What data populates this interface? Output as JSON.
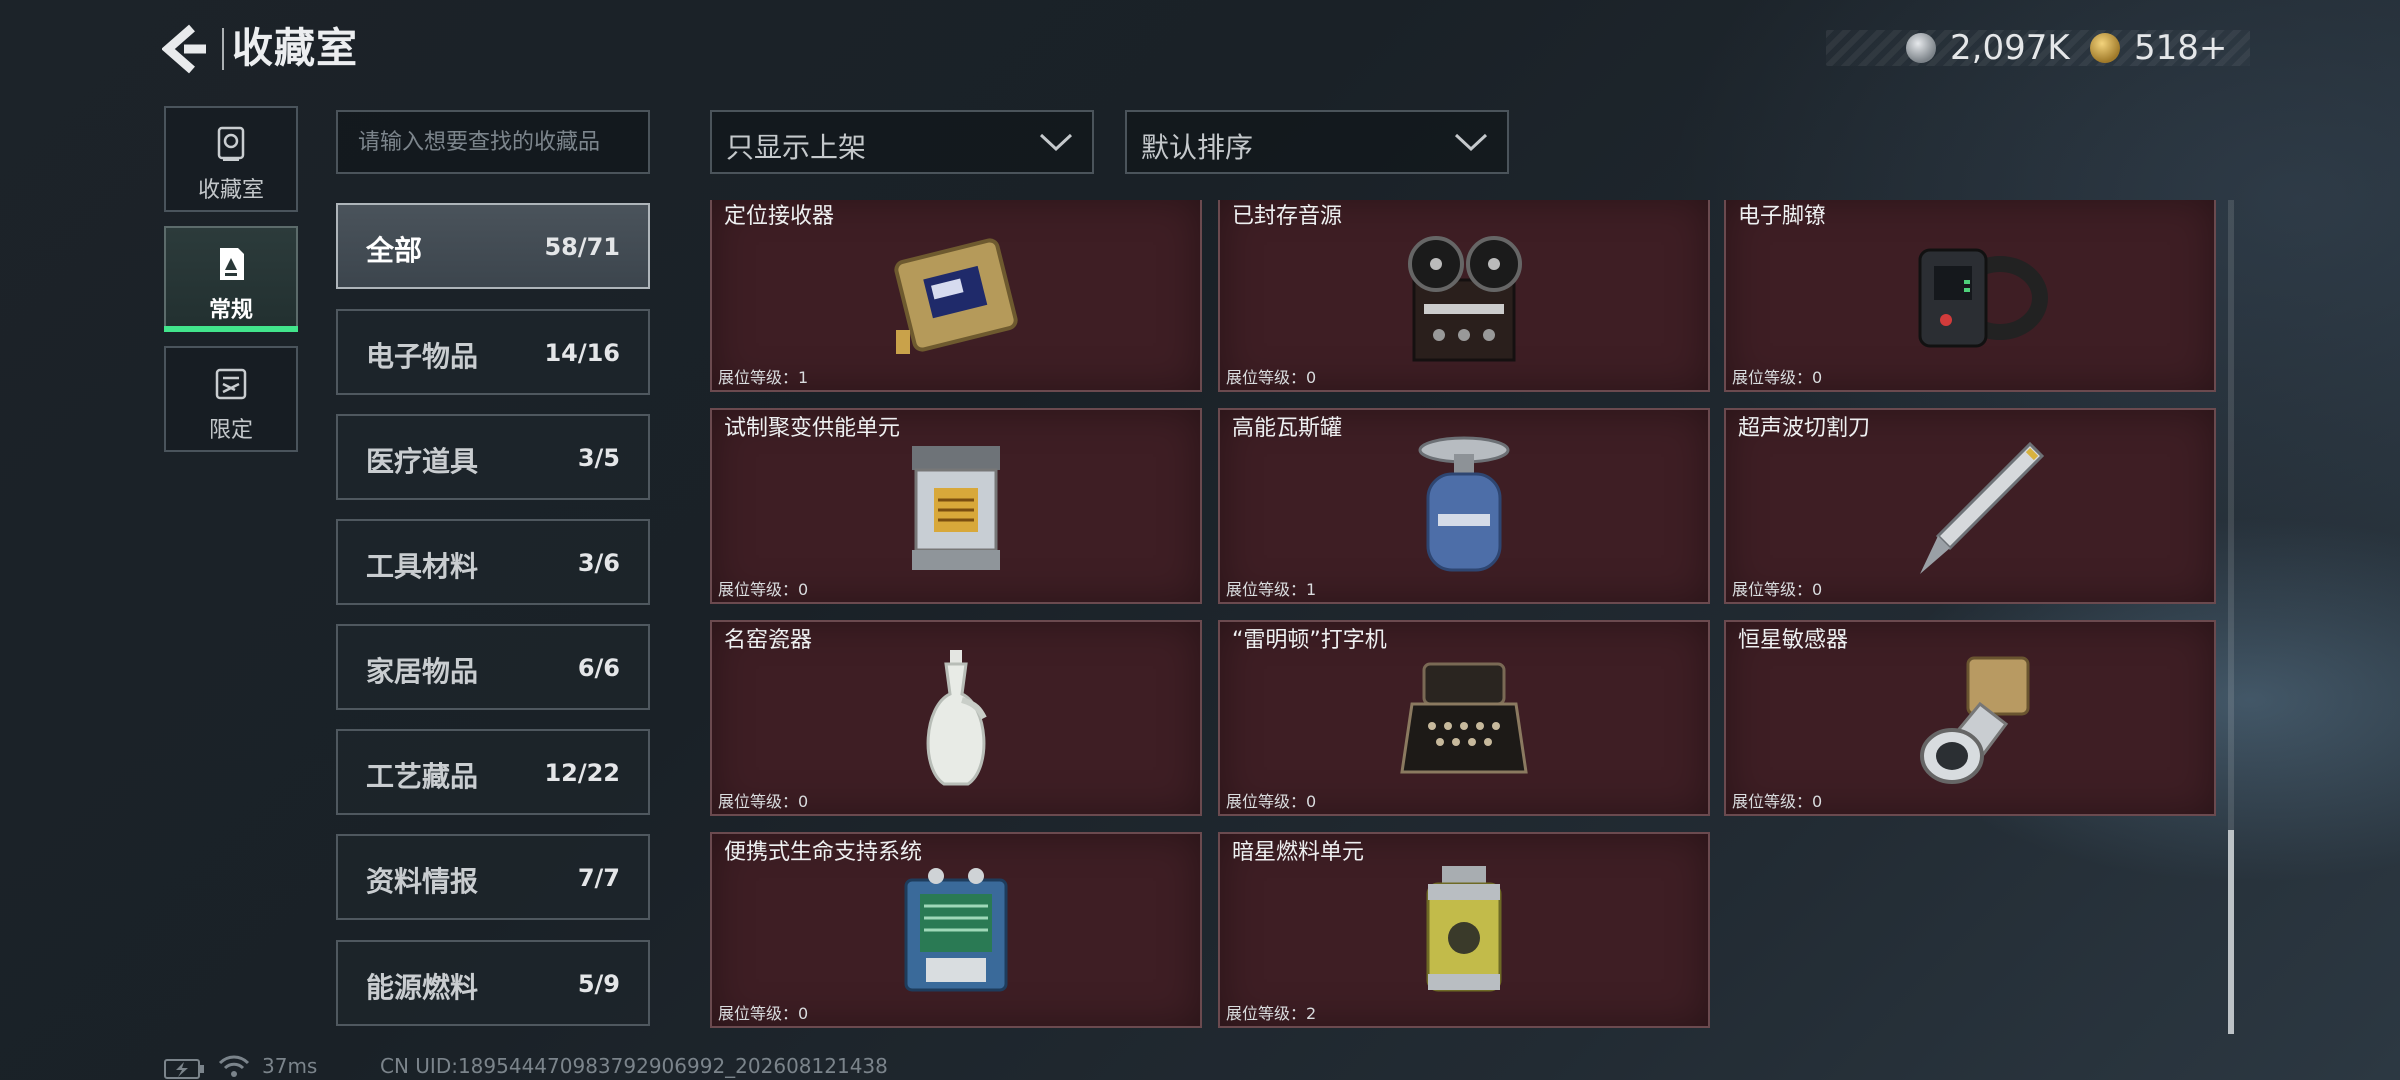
{
  "header": {
    "title": "收藏室"
  },
  "currency": {
    "primary": "2,097K",
    "secondary": "518+"
  },
  "modes": [
    {
      "label": "收藏室",
      "icon": "trophy-icon"
    },
    {
      "label": "常规",
      "icon": "collection-icon",
      "active": true
    },
    {
      "label": "限定",
      "icon": "limited-icon"
    }
  ],
  "search": {
    "placeholder": "请输入想要查找的收藏品"
  },
  "filters": {
    "display_value": "只显示上架",
    "sort_value": "默认排序"
  },
  "categories": [
    {
      "name": "全部",
      "count": "58/71",
      "active": true
    },
    {
      "name": "电子物品",
      "count": "14/16"
    },
    {
      "name": "医疗道具",
      "count": "3/5"
    },
    {
      "name": "工具材料",
      "count": "3/6"
    },
    {
      "name": "家居物品",
      "count": "6/6"
    },
    {
      "name": "工艺藏品",
      "count": "12/22"
    },
    {
      "name": "资料情报",
      "count": "7/7"
    },
    {
      "name": "能源燃料",
      "count": "5/9"
    }
  ],
  "items": [
    {
      "name": "定位接收器",
      "level": "展位等级：1",
      "icon": "receiver-icon"
    },
    {
      "name": "已封存音源",
      "level": "展位等级：0",
      "icon": "reel-recorder-icon"
    },
    {
      "name": "电子脚镣",
      "level": "展位等级：0",
      "icon": "ankle-monitor-icon"
    },
    {
      "name": "试制聚变供能单元",
      "level": "展位等级：0",
      "icon": "fusion-cell-icon"
    },
    {
      "name": "高能瓦斯罐",
      "level": "展位等级：1",
      "icon": "gas-tank-icon"
    },
    {
      "name": "超声波切割刀",
      "level": "展位等级：0",
      "icon": "ultrasonic-knife-icon"
    },
    {
      "name": "名窑瓷器",
      "level": "展位等级：0",
      "icon": "porcelain-vase-icon"
    },
    {
      "name": "“雷明顿”打字机",
      "level": "展位等级：0",
      "icon": "typewriter-icon"
    },
    {
      "name": "恒星敏感器",
      "level": "展位等级：0",
      "icon": "star-sensor-icon"
    },
    {
      "name": "便携式生命支持系统",
      "level": "展位等级：0",
      "icon": "life-support-icon"
    },
    {
      "name": "暗星燃料单元",
      "level": "展位等级：2",
      "icon": "fuel-canister-icon"
    }
  ],
  "status": {
    "ping": "37ms",
    "uid": "CN UID:18954447098379290699​2_202608121438"
  }
}
